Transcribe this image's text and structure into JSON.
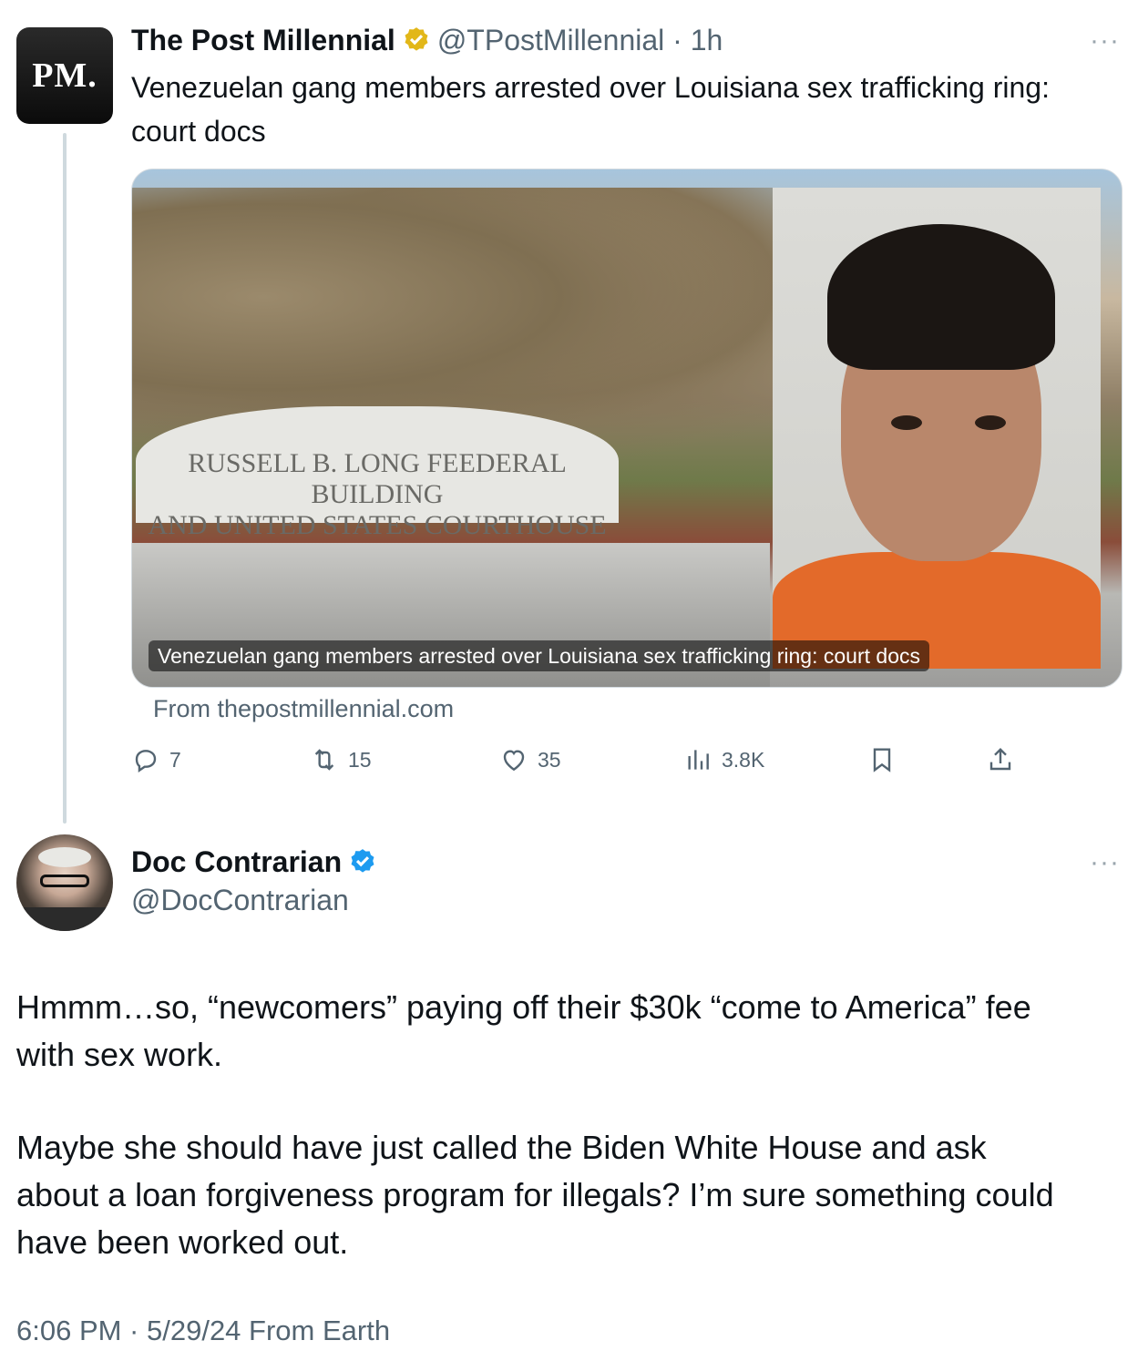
{
  "quoted_tweet": {
    "avatar_text": "PM.",
    "name": "The Post Millennial",
    "handle_time": "@TPostMillennial · 1h",
    "text_line1": "Venezuelan gang members arrested over Louisiana sex trafficking ring:",
    "text_line2": "court docs",
    "media": {
      "sign_line1": "RUSSELL B. LONG FEEDERAL BUILDING",
      "sign_line2": "AND UNITED STATES COURTHOUSE",
      "caption": "Venezuelan gang members arrested over Louisiana sex trafficking ring: court docs"
    },
    "source": "From thepostmillennial.com",
    "actions": {
      "replies": "7",
      "reposts": "15",
      "likes": "35",
      "views": "3.8K"
    },
    "more": "···"
  },
  "main_tweet": {
    "name": "Doc Contrarian",
    "handle": "@DocContrarian",
    "more": "···",
    "para1_line1": "Hmmm…so, “newcomers” paying off their $30k “come to America” fee",
    "para1_line2": "with sex work.",
    "para2_line1": "Maybe she should have just called the Biden White House and ask",
    "para2_line2": "about a loan forgiveness program for illegals? I’m sure something could",
    "para2_line3": "have been worked out.",
    "meta": "6:06 PM · 5/29/24 From Earth"
  },
  "colors": {
    "verified_gold": "#e2b719",
    "verified_blue": "#1d9bf0",
    "secondary_text": "#536471"
  }
}
